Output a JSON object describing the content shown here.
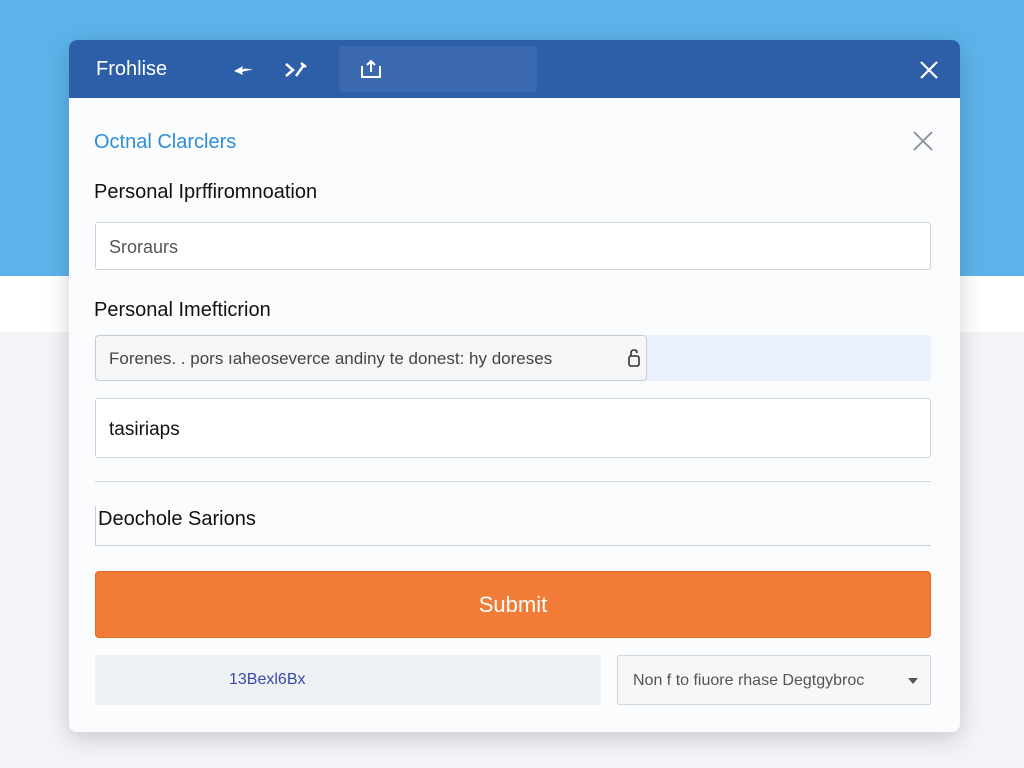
{
  "window": {
    "title": "Frohlise",
    "close_icon": "close-icon"
  },
  "toolbar": {
    "icons": [
      "back-arrow-icon",
      "tools-icon",
      "share-icon"
    ]
  },
  "form": {
    "section_title": "Octnal Clarclers",
    "label_1": "Personal Iprffiromnoation",
    "field_1_value": "Sroraurs",
    "label_2": "Personal Imefticrion",
    "masked_field_value": "Forenes. . pors ıaheoseverce andiny te donest: hy doreses",
    "field_2_value": "tasiriaps",
    "field_3_value": "Deochole Sarions",
    "submit_label": "Submit",
    "footer_text": "13Bexl6Bx",
    "select_value": "Non f to fiuore rhase Degtgybroc"
  },
  "colors": {
    "titlebar": "#2d5ea8",
    "accent_blue": "#2e8ed6",
    "submit_orange": "#f07c38",
    "background_blue": "#5cb3ea"
  }
}
